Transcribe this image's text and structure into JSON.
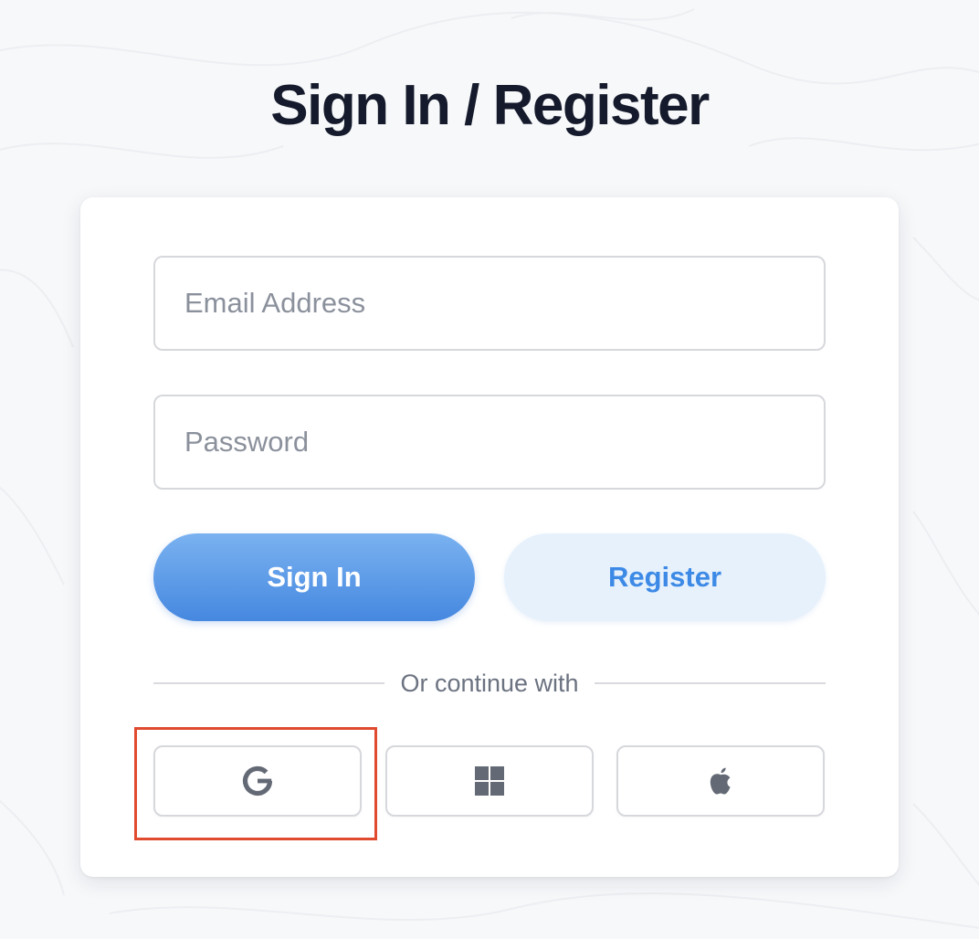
{
  "page": {
    "title": "Sign In / Register"
  },
  "form": {
    "email": {
      "placeholder": "Email Address",
      "value": ""
    },
    "password": {
      "placeholder": "Password",
      "value": ""
    },
    "signin_label": "Sign In",
    "register_label": "Register"
  },
  "divider": {
    "text": "Or continue with"
  },
  "social": {
    "google": {
      "icon": "google-icon"
    },
    "windows": {
      "icon": "windows-icon"
    },
    "apple": {
      "icon": "apple-icon"
    }
  },
  "colors": {
    "primary": "#4688e0",
    "primary_light": "#7ab2f0",
    "register_bg": "#e6f1fc",
    "register_text": "#3d8ae6",
    "title": "#151b2c",
    "highlight": "#e04a2f"
  }
}
